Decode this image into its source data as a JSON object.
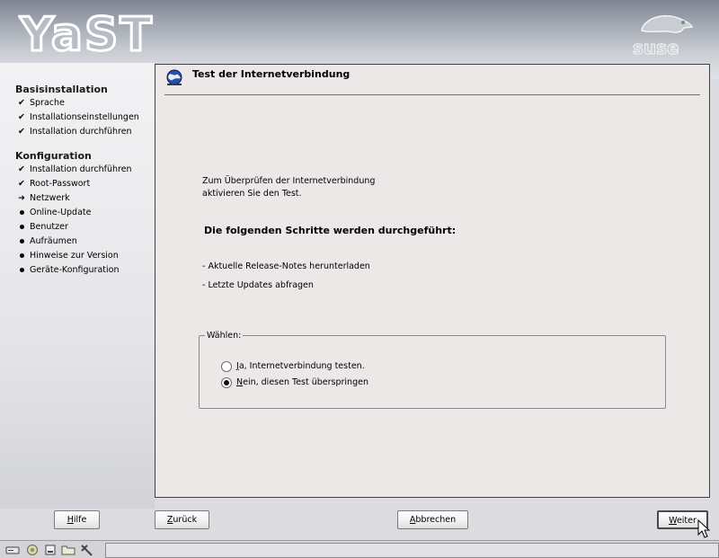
{
  "header": {
    "app_logo_text": "YaST",
    "brand_logo_text": "suse"
  },
  "sidebar": {
    "sections": [
      {
        "title": "Basisinstallation",
        "steps": [
          {
            "label": "Sprache",
            "state": "done"
          },
          {
            "label": "Installationseinstellungen",
            "state": "done"
          },
          {
            "label": "Installation durchführen",
            "state": "done"
          }
        ]
      },
      {
        "title": "Konfiguration",
        "steps": [
          {
            "label": "Installation durchführen",
            "state": "done"
          },
          {
            "label": "Root-Passwort",
            "state": "done"
          },
          {
            "label": "Netzwerk",
            "state": "current"
          },
          {
            "label": "Online-Update",
            "state": "pending"
          },
          {
            "label": "Benutzer",
            "state": "pending"
          },
          {
            "label": "Aufräumen",
            "state": "pending"
          },
          {
            "label": "Hinweise zur Version",
            "state": "pending"
          },
          {
            "label": "Geräte-Konfiguration",
            "state": "pending"
          }
        ]
      }
    ]
  },
  "content": {
    "title": "Test der Internetverbindung",
    "intro_line1": "Zum Überprüfen der Internetverbindung",
    "intro_line2": "aktivieren Sie den Test.",
    "steps_heading": "Die folgenden Schritte werden durchgeführt:",
    "step_items": [
      "- Aktuelle Release-Notes herunterladen",
      "- Letzte Updates abfragen"
    ],
    "choose": {
      "legend": "Wählen:",
      "options": [
        {
          "label": "Ja, Internetverbindung testen.",
          "mnemonic": "J",
          "rest": "a, Internetverbindung testen.",
          "selected": false
        },
        {
          "label": "Nein, diesen Test überspringen",
          "mnemonic": "N",
          "rest": "ein, diesen Test überspringen",
          "selected": true
        }
      ]
    }
  },
  "buttons": {
    "help": {
      "mnemonic": "H",
      "rest": "ilfe"
    },
    "back": {
      "mnemonic": "Z",
      "rest": "urück"
    },
    "abort": {
      "mnemonic": "A",
      "rest": "bbrechen"
    },
    "next": {
      "mnemonic": "W",
      "rest": "eiter"
    }
  },
  "colors": {
    "content_bg": "#ece8e8",
    "sidebar_bg": "#f2f2f4",
    "banner_dark": "#7e8592"
  },
  "taskbar": {
    "icons": [
      "disk-icon",
      "network-icon",
      "terminal-icon",
      "folder-icon",
      "tools-icon"
    ]
  }
}
